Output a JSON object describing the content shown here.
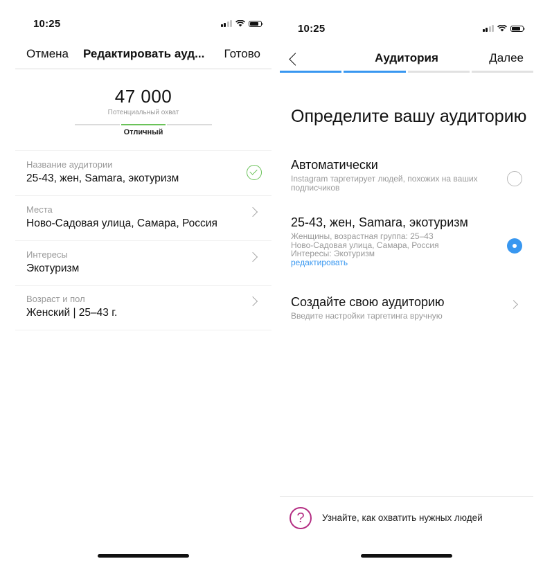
{
  "left_screen": {
    "status": {
      "time": "10:25"
    },
    "nav": {
      "cancel": "Отмена",
      "title": "Редактировать ауд...",
      "done": "Готово"
    },
    "reach": {
      "value": "47 000",
      "label": "Потенциальный охват",
      "quality": "Отличный"
    },
    "rows": [
      {
        "label": "Название аудитории",
        "value": "25-43, жен, Samara, экотуризм",
        "icon": "checkmark-circle-icon"
      },
      {
        "label": "Места",
        "value": "Ново-Садовая улица, Самара, Россия",
        "icon": "chevron-right-icon"
      },
      {
        "label": "Интересы",
        "value": "Экотуризм",
        "icon": "chevron-right-icon"
      },
      {
        "label": "Возраст и пол",
        "value": "Женский | 25–43 г.",
        "icon": "chevron-right-icon"
      }
    ]
  },
  "right_screen": {
    "status": {
      "time": "10:25"
    },
    "nav": {
      "title": "Аудитория",
      "next": "Далее"
    },
    "step_progress": {
      "current": 2,
      "total": 4
    },
    "heading": "Определите вашу аудиторию",
    "options": [
      {
        "title": "Автоматически",
        "description": "Instagram таргетирует людей, похожих на ваших подписчиков",
        "selected": false
      },
      {
        "title": "25-43, жен, Samara, экотуризм",
        "description_lines": [
          "Женщины, возрастная группа: 25–43",
          "Ново-Садовая улица, Самара, Россия",
          "Интересы: Экотуризм"
        ],
        "link": "редактировать",
        "selected": true
      },
      {
        "title": "Создайте свою аудиторию",
        "description": "Введите настройки таргетинга вручную"
      }
    ],
    "help": {
      "text": "Узнайте, как охватить нужных людей",
      "icon": "question-circle-icon"
    }
  },
  "colors": {
    "accent": "#3897f0",
    "success": "#6ac259",
    "help_icon": "#b42e83",
    "muted_text": "#999999"
  }
}
